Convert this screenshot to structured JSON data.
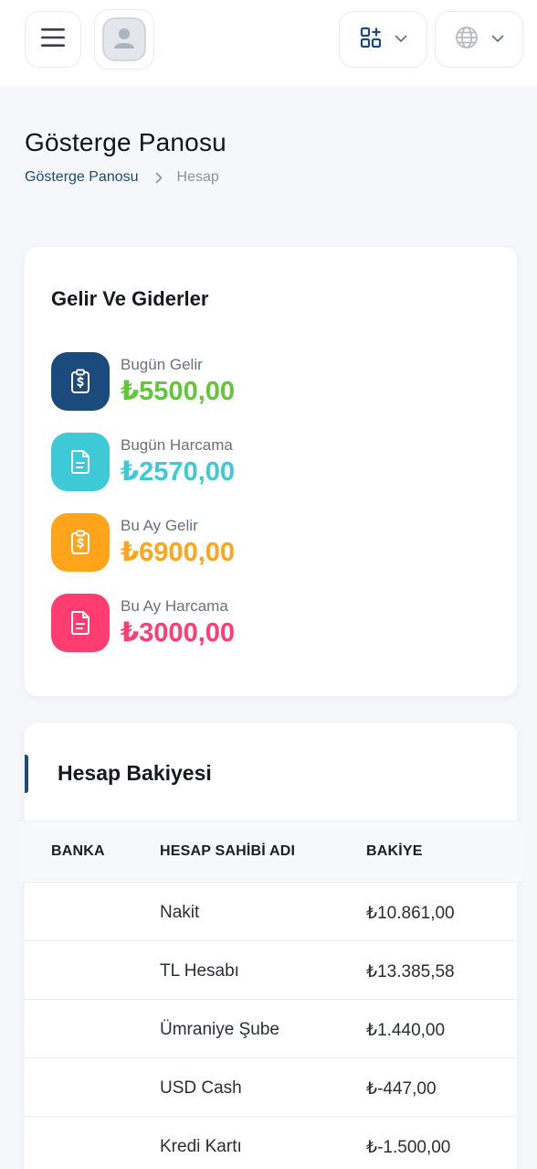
{
  "header": {
    "menu_icon": "hamburger-icon",
    "avatar_icon": "user-avatar-icon",
    "apps_icon": "apps-grid-icon",
    "language_icon": "globe-icon",
    "accent_color": "#1b4a7c"
  },
  "page": {
    "title": "Gösterge Panosu",
    "breadcrumb": [
      {
        "label": "Gösterge Panosu"
      },
      {
        "label": "Hesap"
      }
    ]
  },
  "income_card": {
    "title": "Gelir Ve Giderler",
    "stats": [
      {
        "label": "Bugün Gelir",
        "value": "₺5500,00",
        "icon": "clipboard-dollar-icon",
        "icon_bg": "#1b4a7c",
        "value_color": "#62c63a"
      },
      {
        "label": "Bugün Harcama",
        "value": "₺2570,00",
        "icon": "file-document-icon",
        "icon_bg": "#3ec9d6",
        "value_color": "#3ec9d6"
      },
      {
        "label": "Bu Ay Gelir",
        "value": "₺6900,00",
        "icon": "clipboard-dollar-icon",
        "icon_bg": "#ffa41b",
        "value_color": "#ffa41b"
      },
      {
        "label": "Bu Ay Harcama",
        "value": "₺3000,00",
        "icon": "file-document-icon",
        "icon_bg": "#ff3d70",
        "value_color": "#ff3d70"
      }
    ]
  },
  "balance_card": {
    "title": "Hesap Bakiyesi",
    "columns": [
      "BANKA",
      "HESAP SAHİBİ ADI",
      "BAKİYE"
    ],
    "rows": [
      {
        "bank": "",
        "holder": "Nakit",
        "balance": "₺10.861,00"
      },
      {
        "bank": "",
        "holder": "TL Hesabı",
        "balance": "₺13.385,58"
      },
      {
        "bank": "",
        "holder": "Ümraniye Şube",
        "balance": "₺1.440,00"
      },
      {
        "bank": "",
        "holder": "USD Cash",
        "balance": "₺-447,00"
      },
      {
        "bank": "",
        "holder": "Kredi Kartı",
        "balance": "₺-1.500,00"
      }
    ]
  }
}
